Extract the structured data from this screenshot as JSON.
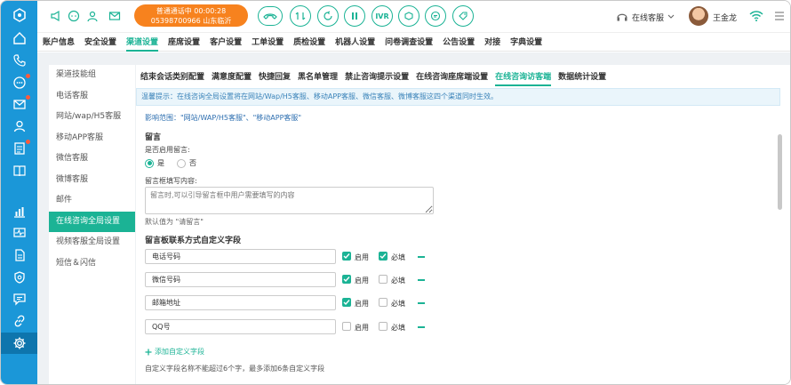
{
  "topbar": {
    "call_status": "普通通话中  00:00:28",
    "call_number": "05398700966 山东临沂",
    "circle_buttons": [
      "hangup",
      "transfer",
      "consult",
      "hold",
      "IVR",
      "mute",
      "chat",
      "tag"
    ],
    "ivr_label": "IVR",
    "agent_status": "在线客服",
    "user_name": "王金龙"
  },
  "mainnav": {
    "items": [
      "账户信息",
      "安全设置",
      "渠道设置",
      "座席设置",
      "客户设置",
      "工单设置",
      "质检设置",
      "机器人设置",
      "问卷调查设置",
      "公告设置",
      "对接",
      "字典设置"
    ],
    "active": "渠道设置"
  },
  "submenu": {
    "items": [
      "渠道技能组",
      "电话客服",
      "网站/wap/H5客服",
      "移动APP客服",
      "微信客服",
      "微博客服",
      "邮件",
      "在线咨询全局设置",
      "视频客服全局设置",
      "短信＆闪信"
    ],
    "active": "在线咨询全局设置"
  },
  "tabs": {
    "items": [
      "结束会话类别配置",
      "满意度配置",
      "快捷回复",
      "黑名单管理",
      "禁止咨询提示设置",
      "在线咨询座席端设置",
      "在线咨询访客端",
      "数据统计设置"
    ],
    "active": "在线咨询访客端"
  },
  "notice": "温馨提示：在线咨询全局设置将在网站/Wap/H5客服、移动APP客服、微信客服、微博客服这四个渠道同时生效。",
  "scope": "影响范围：\"网站/WAP/H5客服\"、\"移动APP客服\"",
  "message": {
    "title": "留言",
    "enable_label": "是否启用留言:",
    "yes": "是",
    "no": "否",
    "selected": "是",
    "box_label": "留言框填写内容:",
    "box_placeholder": "留言时,可以引导留言框中用户需要填写的内容",
    "default_hint": "默认值为 \"请留言\""
  },
  "custom_fields": {
    "title": "留言板联系方式自定义字段",
    "enable_label": "启用",
    "required_label": "必填",
    "rows": [
      {
        "name": "电话号码",
        "enabled": true,
        "required": true
      },
      {
        "name": "微信号码",
        "enabled": true,
        "required": false
      },
      {
        "name": "邮箱地址",
        "enabled": true,
        "required": false
      },
      {
        "name": "QQ号",
        "enabled": false,
        "required": false
      }
    ],
    "add_label": "添加自定义字段",
    "hint": "自定义字段名称不能超过6个字，最多添加6条自定义字段"
  },
  "colors": {
    "accent": "#1bb395",
    "rail": "#1b97d8",
    "call_pill": "#f7821e",
    "notice_bg": "#eaf5fb"
  }
}
